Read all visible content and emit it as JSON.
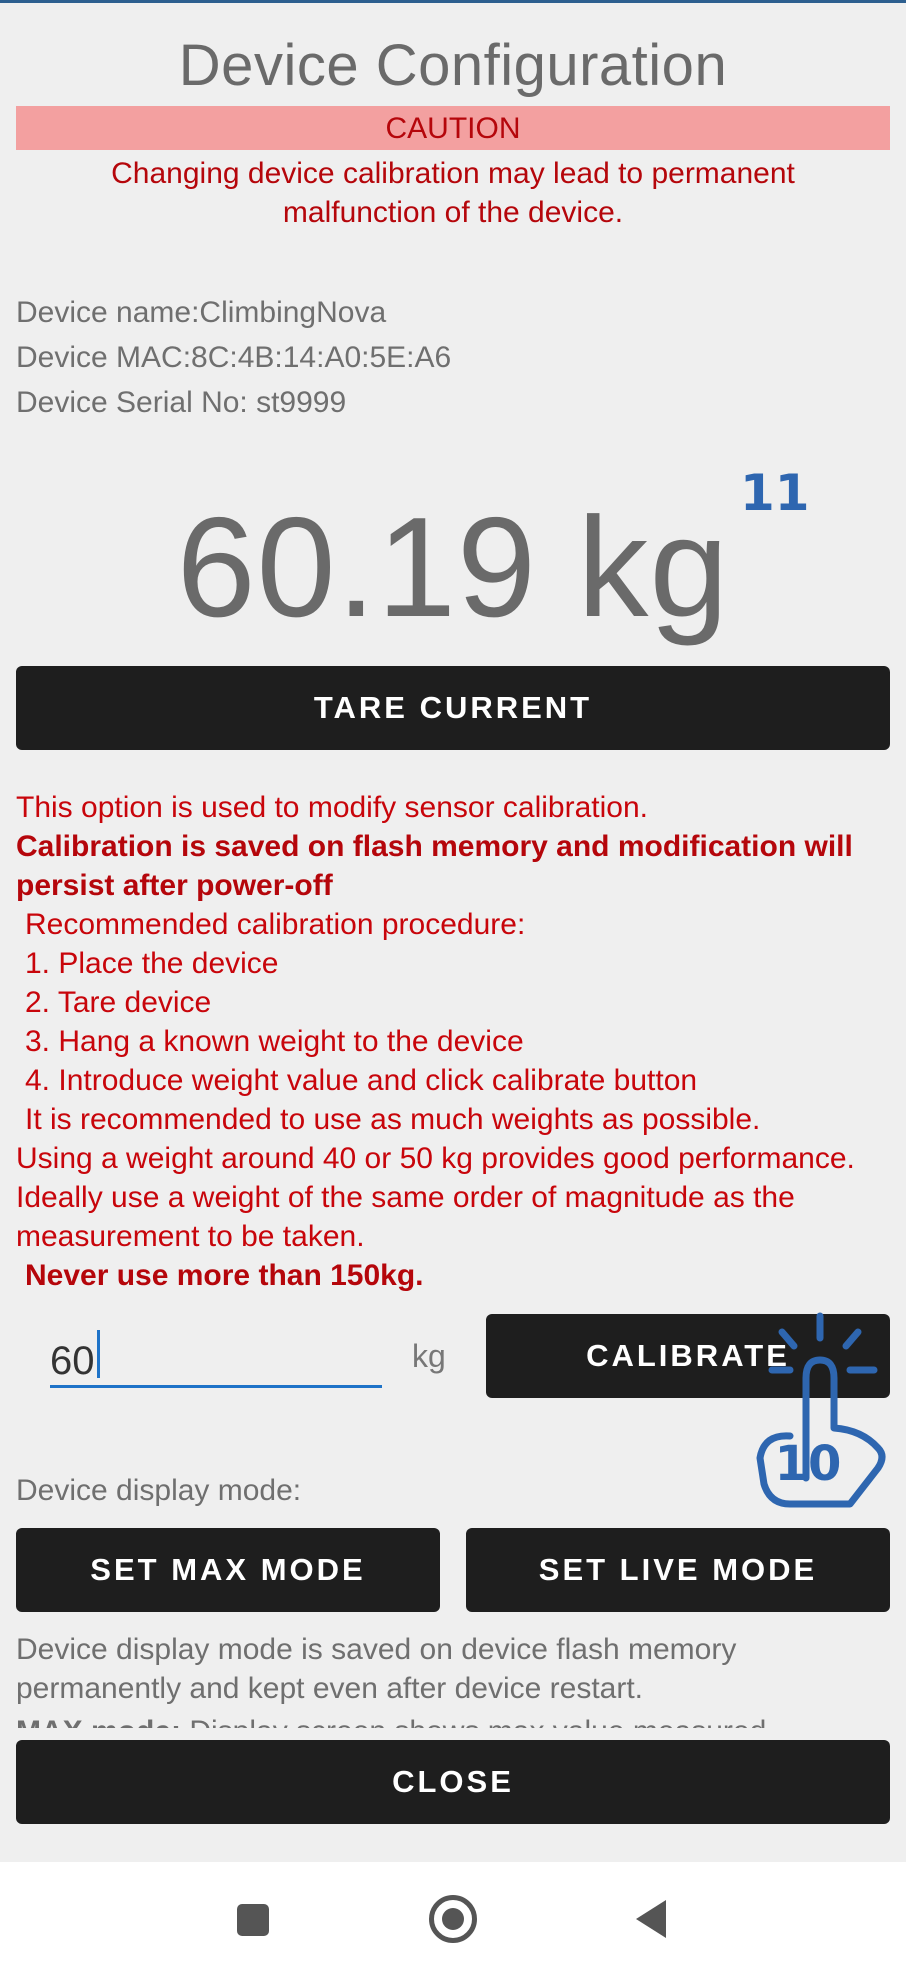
{
  "header": {
    "title": "Device Configuration"
  },
  "caution": {
    "label": "CAUTION",
    "message": "Changing device calibration may lead to permanent malfunction of the device."
  },
  "device": {
    "name_line": "Device name:ClimbingNova",
    "mac_line": "Device MAC:8C:4B:14:A0:5E:A6",
    "serial_line": "Device Serial No: st9999"
  },
  "reading": {
    "value": "60.19 kg"
  },
  "annotations": {
    "step_11": "11",
    "step_10": "10"
  },
  "buttons": {
    "tare": "TARE CURRENT",
    "calibrate": "CALIBRATE",
    "set_max": "SET MAX MODE",
    "set_live": "SET LIVE MODE",
    "close": "CLOSE"
  },
  "calibration_help": {
    "intro": "This option is used to modify sensor calibration.",
    "persist": "Calibration is saved on flash memory and modification will persist after power-off",
    "procedure_title": "Recommended calibration procedure:",
    "steps": [
      "1. Place the device",
      "2. Tare device",
      "3. Hang a known weight to the device",
      "4. Introduce weight value and click calibrate button"
    ],
    "recommend": "It is recommended to use as much weights as possible.",
    "advice": "Using a weight around 40 or 50 kg provides good performance. Ideally use a weight of the same order of magnitude as the measurement to be taken.",
    "limit": "Never use more than 150kg."
  },
  "weight_input": {
    "value": "60",
    "unit": "kg"
  },
  "display_mode": {
    "label": "Device display mode:",
    "description": "Device display mode is saved on device flash memory permanently and kept even after device restart.",
    "max_mode_prefix": "MAX mode:",
    "max_mode_text": "Display screen shows max value measured"
  },
  "colors": {
    "caution_bg": "#f3a0a0",
    "warning_text": "#c8050b",
    "button_bg": "#1e1e1e",
    "accent": "#1e73c8",
    "annotation": "#2e66b0"
  }
}
